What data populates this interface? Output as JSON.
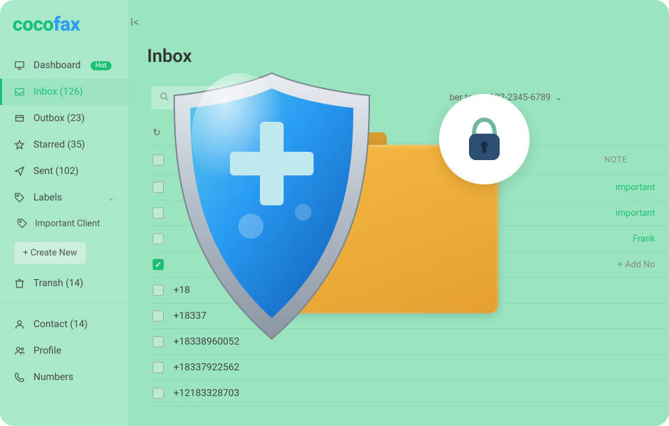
{
  "brand": {
    "part1": "coco",
    "part2": "fax"
  },
  "sidebar": {
    "items": [
      {
        "icon": "monitor",
        "label": "Dashboard",
        "hot": "Hot"
      },
      {
        "icon": "inbox",
        "label": "Inbox  (126)",
        "active": true
      },
      {
        "icon": "outbox",
        "label": "Outbox  (23)"
      },
      {
        "icon": "star",
        "label": "Starred  (35)"
      },
      {
        "icon": "send",
        "label": "Sent  (102)"
      },
      {
        "icon": "tag",
        "label": "Labels",
        "expand": true
      }
    ],
    "sub_label": {
      "icon": "tag",
      "label": "Important Client"
    },
    "create_new": "+  Create New",
    "trash": {
      "label": "Transh  (14)"
    },
    "bottom": [
      {
        "icon": "user",
        "label": "Contact  (14)"
      },
      {
        "icon": "profile",
        "label": "Profile"
      },
      {
        "icon": "phone",
        "label": "Numbers"
      }
    ]
  },
  "main": {
    "title": "Inbox",
    "search_placeholder": "Search",
    "fax_dropdown": "ber to: +1 182-2345-6789",
    "col_note_header": "NOTE",
    "rows": [
      {
        "number": "",
        "note": "important",
        "checked": false
      },
      {
        "number": "",
        "note": "important",
        "checked": false
      },
      {
        "number": "",
        "note": "Frank",
        "checked": false
      },
      {
        "number": "",
        "note": "Add No",
        "add": true,
        "checked": true
      },
      {
        "number": "+18",
        "checked": false
      },
      {
        "number": "+18337",
        "checked": false
      },
      {
        "number": "+18338960052",
        "checked": false
      },
      {
        "number": "+18337922562",
        "checked": false
      },
      {
        "number": "+12183328703",
        "checked": false
      }
    ]
  }
}
